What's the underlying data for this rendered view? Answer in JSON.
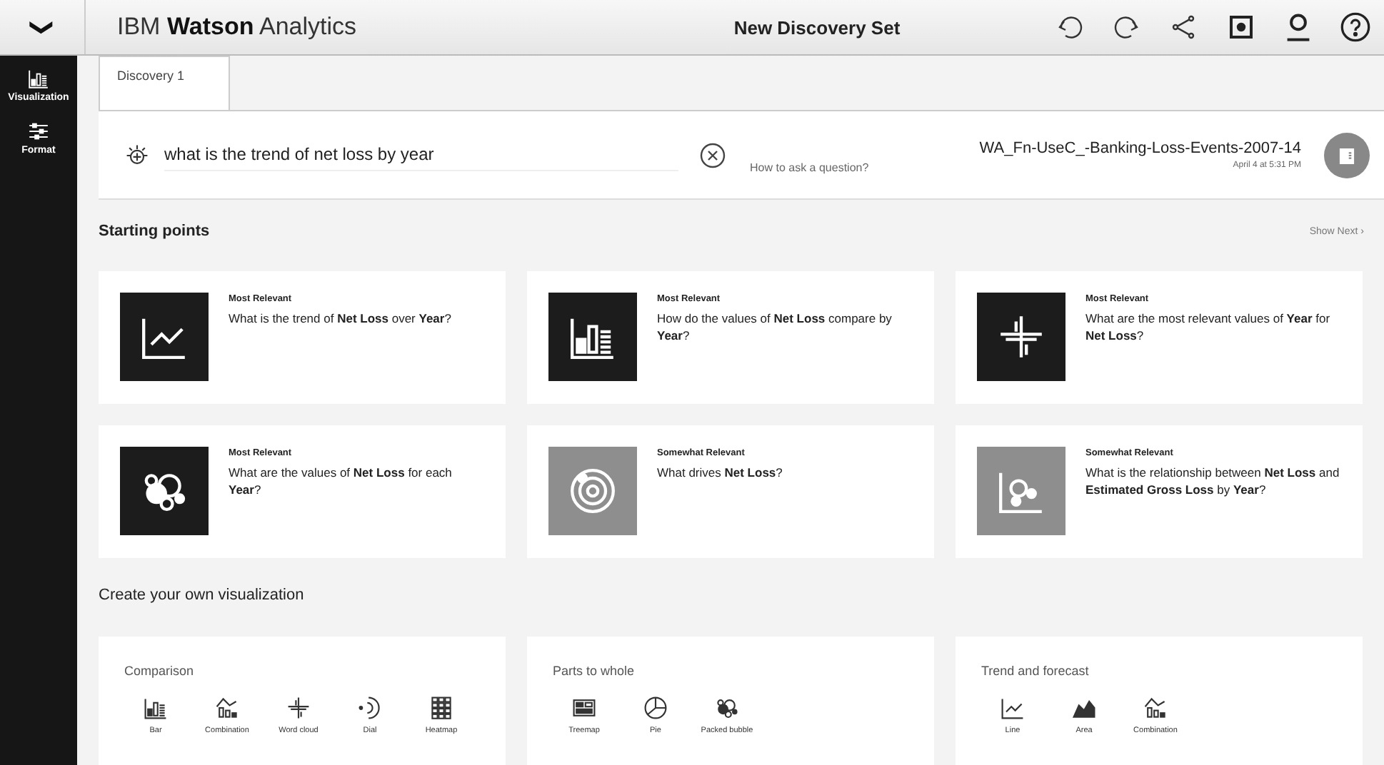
{
  "header": {
    "menu_glyph": "❯",
    "brand": "IBM **Watson** Analytics",
    "title": "New Discovery Set"
  },
  "sidebar": {
    "items": [
      {
        "label": "Visualization",
        "kind": "bars"
      },
      {
        "label": "Format",
        "kind": "sliders"
      }
    ]
  },
  "tabs": [
    {
      "label": "Discovery 1",
      "selected": true
    }
  ],
  "question": {
    "value": "what is the trend of net loss by year",
    "help_link": "How to ask a question?"
  },
  "dataset": {
    "name": "WA_Fn-UseC_-Banking-Loss-Events-2007-14",
    "date": "April 4 at 5:31 PM"
  },
  "starting_points": {
    "title": "Starting points",
    "show_next": "Show Next",
    "show_next_glyph": "›",
    "cards": [
      {
        "relevance": "Most Relevant",
        "text": "What is the trend of **Net Loss** over **Year**?",
        "kind": "line",
        "dimmed": false
      },
      {
        "relevance": "Most Relevant",
        "text": "How do the values of **Net Loss** compare by **Year**?",
        "kind": "bar",
        "dimmed": false
      },
      {
        "relevance": "Most Relevant",
        "text": "What are the most relevant values of **Year** for **Net Loss**?",
        "kind": "cloud",
        "dimmed": false
      },
      {
        "relevance": "Most Relevant",
        "text": "What are the values of **Net Loss** for each **Year**?",
        "kind": "bubble",
        "dimmed": false
      },
      {
        "relevance": "Somewhat Relevant",
        "text": "What drives **Net Loss**?",
        "kind": "spiral",
        "dimmed": true
      },
      {
        "relevance": "Somewhat Relevant",
        "text": "What is the relationship between **Net Loss** and **Estimated Gross Loss** by **Year**?",
        "kind": "scatter",
        "dimmed": true
      }
    ]
  },
  "create": {
    "title": "Create your own visualization",
    "groups": [
      {
        "title": "Comparison",
        "items": [
          {
            "label": "Bar",
            "kind": "bar"
          },
          {
            "label": "Combination",
            "kind": "combo"
          },
          {
            "label": "Word cloud",
            "kind": "cloud"
          },
          {
            "label": "Dial",
            "kind": "dial"
          },
          {
            "label": "Heatmap",
            "kind": "heatmap"
          }
        ]
      },
      {
        "title": "Parts to whole",
        "items": [
          {
            "label": "Treemap",
            "kind": "treemap"
          },
          {
            "label": "Pie",
            "kind": "pie"
          },
          {
            "label": "Packed bubble",
            "kind": "bubble"
          }
        ]
      },
      {
        "title": "Trend and forecast",
        "items": [
          {
            "label": "Line",
            "kind": "line"
          },
          {
            "label": "Area",
            "kind": "area"
          },
          {
            "label": "Combination",
            "kind": "combo"
          }
        ]
      }
    ]
  }
}
